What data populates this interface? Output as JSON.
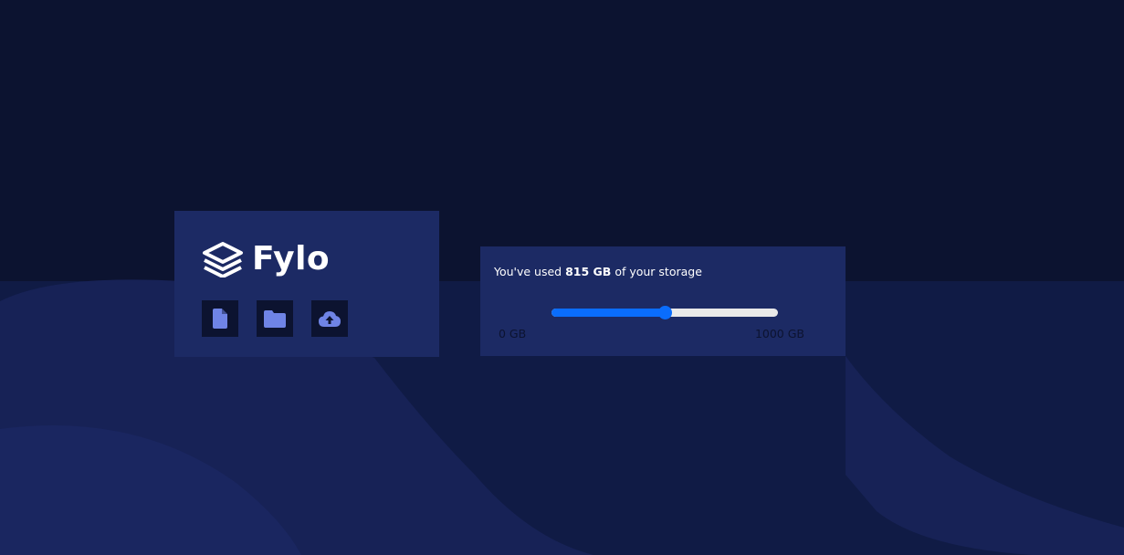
{
  "brand": {
    "name": "Fylo",
    "logo_icon": "layers-stack-icon"
  },
  "actions": [
    {
      "icon": "document-icon"
    },
    {
      "icon": "folder-icon"
    },
    {
      "icon": "cloud-upload-icon"
    }
  ],
  "storage": {
    "prefix": "You've used",
    "used": "815 GB",
    "suffix": "of your storage",
    "min_label": "0 GB",
    "max_label": "1000 GB",
    "slider_value_fraction": 0.5
  },
  "colors": {
    "page_background": "#0c1330",
    "card_background": "#1c2a64",
    "icon_accent": "#6f84e6",
    "slider_accent": "#0a6dfd"
  }
}
